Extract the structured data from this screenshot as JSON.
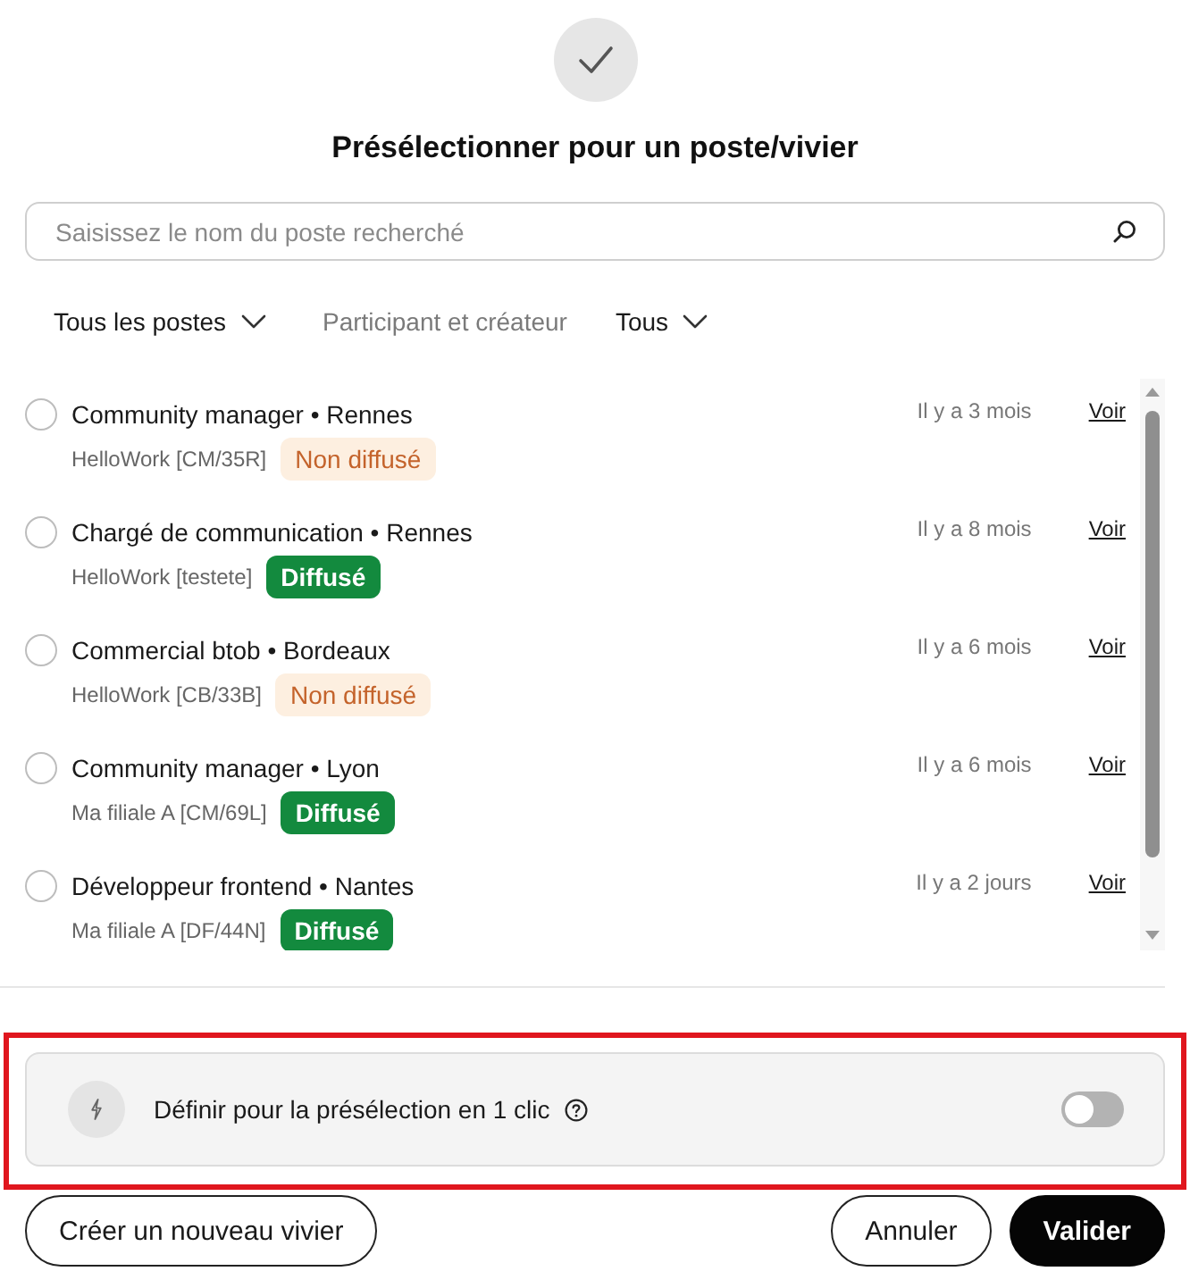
{
  "title": "Présélectionner pour un poste/vivier",
  "search": {
    "placeholder": "Saisissez le nom du poste recherché"
  },
  "filters": [
    {
      "kind": "dropdown",
      "label": "Tous les postes"
    },
    {
      "kind": "label",
      "label": "Participant et créateur"
    },
    {
      "kind": "dropdown",
      "label": "Tous"
    }
  ],
  "jobs": [
    {
      "title": "Community manager • Rennes",
      "reference": "HelloWork [CM/35R]",
      "status": {
        "label": "Non diffusé",
        "kind": "warning"
      },
      "posted": "Il y a 3 mois",
      "link": "Voir",
      "selected": false
    },
    {
      "title": "Chargé de communication • Rennes",
      "reference": "HelloWork [testete]",
      "status": {
        "label": "Diffusé",
        "kind": "success"
      },
      "posted": "Il y a 8 mois",
      "link": "Voir",
      "selected": false
    },
    {
      "title": "Commercial btob • Bordeaux",
      "reference": "HelloWork [CB/33B]",
      "status": {
        "label": "Non diffusé",
        "kind": "warning"
      },
      "posted": "Il y a 6 mois",
      "link": "Voir",
      "selected": false
    },
    {
      "title": "Community manager • Lyon",
      "reference": "Ma filiale A [CM/69L]",
      "status": {
        "label": "Diffusé",
        "kind": "success"
      },
      "posted": "Il y a 6 mois",
      "link": "Voir",
      "selected": false
    },
    {
      "title": "Développeur frontend • Nantes",
      "reference": "Ma filiale A [DF/44N]",
      "status": {
        "label": "Diffusé",
        "kind": "success"
      },
      "posted": "Il y a 2 jours",
      "link": "Voir",
      "selected": false
    }
  ],
  "one_click": {
    "label": "Définir pour la présélection en 1 clic",
    "on": false,
    "highlighted": true
  },
  "footer": {
    "left": [
      {
        "label": "Créer un nouveau vivier",
        "kind": "outline"
      }
    ],
    "right": [
      {
        "label": "Annuler",
        "kind": "outline"
      },
      {
        "label": "Valider",
        "kind": "primary"
      }
    ]
  }
}
